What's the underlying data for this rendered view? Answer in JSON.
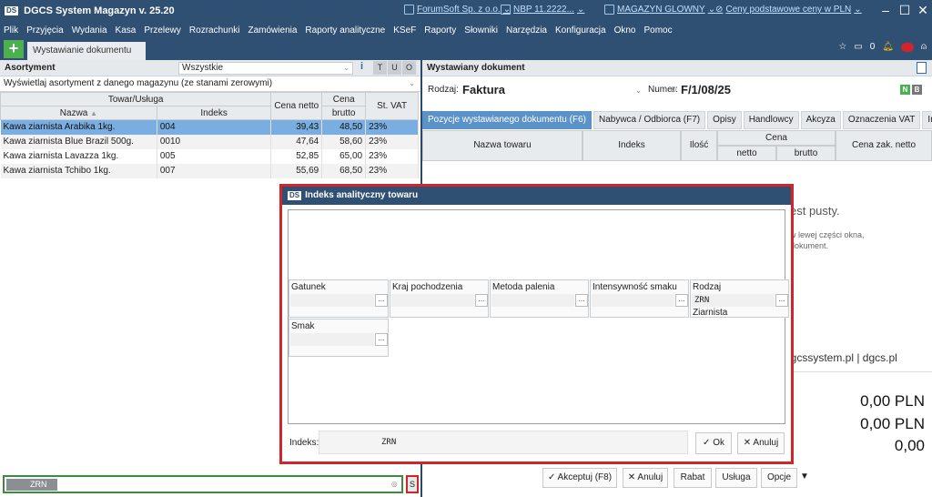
{
  "app": {
    "title": "DGCS System Magazyn v. 25.20",
    "company": "ForumSoft Sp. z o.o.",
    "rate": "NBP 11.2222...",
    "warehouse": "MAGAZYN GLOWNY",
    "prices": "Ceny podstawowe ceny w PLN"
  },
  "menu": [
    "Plik",
    "Przyjęcia",
    "Wydania",
    "Kasa",
    "Przelewy",
    "Rozrachunki",
    "Zamówienia",
    "Raporty analityczne",
    "KSeF",
    "Raporty",
    "Słowniki",
    "Narzędzia",
    "Konfiguracja",
    "Okno",
    "Pomoc"
  ],
  "toolbar": {
    "plus": "+",
    "tab": "Wystawianie dokumentu",
    "count": "0"
  },
  "left": {
    "header": "Asortyment",
    "filter_value": "Wszystkie",
    "btn_t": "T",
    "btn_u": "U",
    "btn_o": "O",
    "info": "i",
    "stock_filter": "Wyświetlaj asortyment z danego magazynu (ze stanami zerowymi)",
    "columns": {
      "group": "Towar/Usługa",
      "name": "Nazwa",
      "index": "Indeks",
      "net": "Cena netto",
      "price_group": "Cena",
      "gross": "brutto",
      "vat": "St. VAT"
    },
    "rows": [
      {
        "name": "Kawa ziarnista Arabika 1kg.",
        "index": "004",
        "net": "39,43",
        "gross": "48,50",
        "vat": "23%"
      },
      {
        "name": "Kawa ziarnista Blue Brazil 500g.",
        "index": "0010",
        "net": "47,64",
        "gross": "58,60",
        "vat": "23%"
      },
      {
        "name": "Kawa ziarnista Lavazza 1kg.",
        "index": "005",
        "net": "52,85",
        "gross": "65,00",
        "vat": "23%"
      },
      {
        "name": "Kawa ziarnista Tchibo 1kg.",
        "index": "007",
        "net": "55,69",
        "gross": "68,50",
        "vat": "23%"
      }
    ],
    "search_chip": "ZRN",
    "s_button": "S"
  },
  "right": {
    "header": "Wystawiany dokument",
    "type_label": "Rodzaj:",
    "type_value": "Faktura",
    "number_label": "Numer:",
    "number_value": "F/1/08/25",
    "badge_n": "N",
    "badge_b": "B",
    "tabs": [
      "Pozycje wystawianego dokumentu (F6)",
      "Nabywca / Odbiorca (F7)",
      "Opisy",
      "Handlowcy",
      "Akcyza",
      "Oznaczenia VAT",
      "Intrastat"
    ],
    "grid": {
      "name": "Nazwa towaru",
      "index": "Indeks",
      "qty": "Ilość",
      "price": "Cena",
      "net": "netto",
      "gross": "brutto",
      "purchase": "Cena zak. netto"
    },
    "empty_text": "est pusty.",
    "empty_hint_1": "w lewej części okna,",
    "empty_hint_2": "dokument.",
    "site_text": "dgcssystem.pl  |  dgcs.pl",
    "totals": [
      "0,00 PLN",
      "0,00 PLN",
      "0,00"
    ],
    "buttons": {
      "accept": "✓ Akceptuj (F8)",
      "cancel": "✕ Anuluj",
      "discount": "Rabat",
      "service": "Usługa",
      "options": "Opcje",
      "more": "▼"
    }
  },
  "modal": {
    "title": "Indeks analityczny towaru",
    "fields": [
      {
        "label": "Gatunek",
        "value": ""
      },
      {
        "label": "Kraj pochodzenia",
        "value": ""
      },
      {
        "label": "Metoda palenia",
        "value": ""
      },
      {
        "label": "Intensywność smaku",
        "value": ""
      },
      {
        "label": "Rodzaj",
        "value": "ZRN",
        "sub": "Ziarnista"
      },
      {
        "label": "Smak",
        "value": ""
      }
    ],
    "dots": "...",
    "index_label": "Indeks:",
    "index_value": "ZRN",
    "ok": "✓ Ok",
    "cancel": "✕ Anuluj"
  }
}
